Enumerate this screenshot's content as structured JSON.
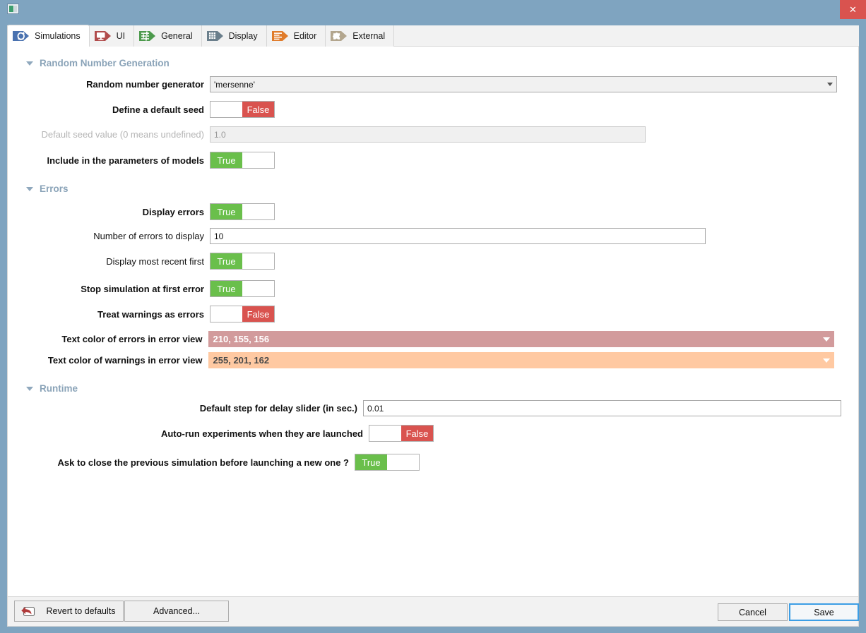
{
  "window": {
    "icon": "window-icon",
    "close_label": "✕"
  },
  "tabs": [
    {
      "id": "simulations",
      "label": "Simulations",
      "icon": "refresh-icon",
      "color": "#4a72b0",
      "active": true
    },
    {
      "id": "ui",
      "label": "UI",
      "icon": "monitor-icon",
      "color": "#b14c4c",
      "active": false
    },
    {
      "id": "general",
      "label": "General",
      "icon": "sliders-icon",
      "color": "#4c9a4c",
      "active": false
    },
    {
      "id": "display",
      "label": "Display",
      "icon": "grid-icon",
      "color": "#6b7f8c",
      "active": false
    },
    {
      "id": "editor",
      "label": "Editor",
      "icon": "lines-icon",
      "color": "#e07b2a",
      "active": false
    },
    {
      "id": "external",
      "label": "External",
      "icon": "puzzle-icon",
      "color": "#b3a68e",
      "active": false
    }
  ],
  "sections": {
    "rng": {
      "title": "Random Number Generation",
      "expanded": true
    },
    "errors": {
      "title": "Errors",
      "expanded": true
    },
    "runtime": {
      "title": "Runtime",
      "expanded": true
    }
  },
  "fields": {
    "rng_generator": {
      "label": "Random number generator",
      "value": "'mersenne'"
    },
    "define_seed": {
      "label": "Define a default seed",
      "value": "False",
      "on": false
    },
    "seed_value": {
      "label": "Default seed value (0 means undefined)",
      "value": "1.0",
      "disabled": true
    },
    "include_params": {
      "label": "Include in the parameters of models",
      "value": "True",
      "on": true
    },
    "display_errors": {
      "label": "Display errors",
      "value": "True",
      "on": true
    },
    "num_errors": {
      "label": "Number of errors to display",
      "value": "10"
    },
    "recent_first": {
      "label": "Display most recent first",
      "value": "True",
      "on": true
    },
    "stop_first_error": {
      "label": "Stop simulation at first error",
      "value": "True",
      "on": true
    },
    "warnings_as_errors": {
      "label": "Treat warnings as errors",
      "value": "False",
      "on": false
    },
    "error_color": {
      "label": "Text color of errors in error view",
      "value": "210, 155, 156",
      "swatch": "#d29b9c"
    },
    "warning_color": {
      "label": "Text color of warnings in error view",
      "value": "255, 201, 162",
      "swatch": "#ffc9a2"
    },
    "delay_step": {
      "label": "Default step for delay slider (in sec.)",
      "value": "0.01"
    },
    "autorun": {
      "label": "Auto-run experiments when they are launched",
      "value": "False",
      "on": false
    },
    "ask_close": {
      "label": "Ask to close the previous simulation before launching a new one ?",
      "value": "True",
      "on": true
    }
  },
  "buttons": {
    "revert": {
      "label": "Revert to defaults",
      "icon": "undo-arrow-icon"
    },
    "advanced": {
      "label": "Advanced..."
    },
    "cancel": {
      "label": "Cancel"
    },
    "save": {
      "label": "Save"
    }
  }
}
